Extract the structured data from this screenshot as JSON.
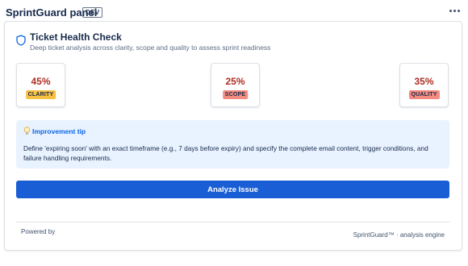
{
  "panel": {
    "title": "SprintGuard panel",
    "env_badge": "DEV",
    "more_icon": "more-horizontal-icon"
  },
  "card": {
    "icon": "shield-icon",
    "title": "Ticket Health Check",
    "subtitle": "Deep ticket analysis across clarity, scope and quality to assess sprint readiness"
  },
  "metrics": [
    {
      "value": "45%",
      "label": "CLARITY",
      "label_bg": "#f8c142"
    },
    {
      "value": "25%",
      "label": "SCOPE",
      "label_bg": "#f48b7f"
    },
    {
      "value": "35%",
      "label": "QUALITY",
      "label_bg": "#f48b7f"
    }
  ],
  "metric_value_color": "#ae2e24",
  "tip": {
    "icon": "lightbulb-icon",
    "title": "Improvement tip",
    "body": "Define 'expiring soon' with an exact timeframe (e.g., 7 days before expiry) and specify the complete email content, trigger conditions, and failure handling requirements.",
    "background": "#e9f2ff",
    "title_color": "#0c66e4"
  },
  "actions": {
    "analyze_label": "Analyze Issue",
    "button_color": "#1a5ed6"
  },
  "footer": {
    "powered_by": "Powered by",
    "engine_credit": "SprintGuard™ · analysis engine"
  }
}
